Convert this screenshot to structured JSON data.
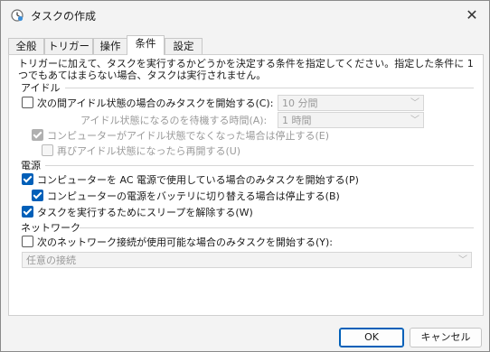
{
  "window": {
    "title": "タスクの作成",
    "close_glyph": "✕"
  },
  "tabs": [
    {
      "label": "全般"
    },
    {
      "label": "トリガー"
    },
    {
      "label": "操作"
    },
    {
      "label": "条件"
    },
    {
      "label": "設定"
    }
  ],
  "active_tab": "条件",
  "description": "トリガーに加えて、タスクを実行するかどうかを決定する条件を指定してください。指定した条件に 1 つでもあてはまらない場合、タスクは実行されません。",
  "idle": {
    "section_label": "アイドル",
    "start_only_if_idle": {
      "label": "次の間アイドル状態の場合のみタスクを開始する(C):",
      "checked": false
    },
    "idle_duration": {
      "value": "10 分間"
    },
    "wait_label": "アイドル状態になるのを待機する時間(A):",
    "wait_duration": {
      "value": "1 時間"
    },
    "stop_if_not_idle": {
      "label": "コンピューターがアイドル状態でなくなった場合は停止する(E)",
      "checked": true,
      "disabled": true
    },
    "restart_if_idle_again": {
      "label": "再びアイドル状態になったら再開する(U)",
      "checked": false,
      "disabled": true
    }
  },
  "power": {
    "section_label": "電源",
    "start_only_ac": {
      "label": "コンピューターを AC 電源で使用している場合のみタスクを開始する(P)",
      "checked": true
    },
    "stop_on_battery": {
      "label": "コンピューターの電源をバッテリに切り替える場合は停止する(B)",
      "checked": true
    },
    "wake_to_run": {
      "label": "タスクを実行するためにスリープを解除する(W)",
      "checked": true
    }
  },
  "network": {
    "section_label": "ネットワーク",
    "start_only_network": {
      "label": "次のネットワーク接続が使用可能な場合のみタスクを開始する(Y):",
      "checked": false
    },
    "connection": {
      "value": "任意の接続"
    }
  },
  "buttons": {
    "ok": "OK",
    "cancel": "キャンセル"
  },
  "colors": {
    "accent": "#005fb8",
    "panel_bg": "#ffffff",
    "window_bg": "#f3f3f3"
  }
}
